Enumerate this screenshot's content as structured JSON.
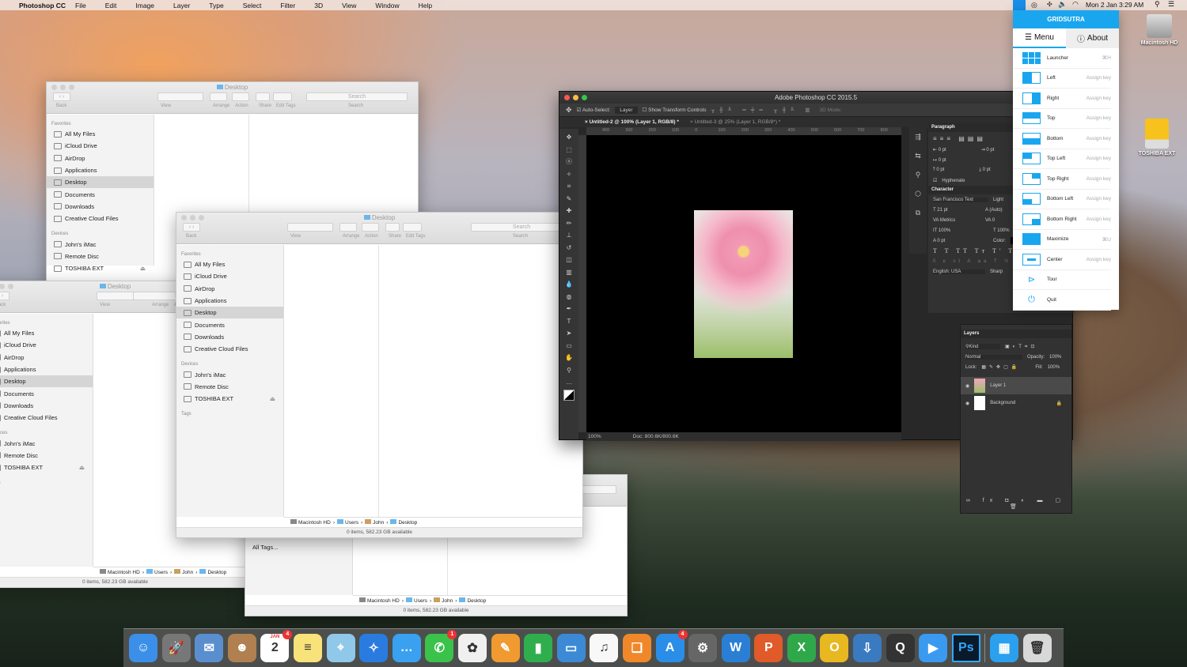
{
  "menubar": {
    "app": "Photoshop CC",
    "items": [
      "File",
      "Edit",
      "Image",
      "Layer",
      "Type",
      "Select",
      "Filter",
      "3D",
      "View",
      "Window",
      "Help"
    ],
    "clock": "Mon 2 Jan  3:29 AM"
  },
  "finder": {
    "title": "Desktop",
    "toolbar": {
      "back": "Back",
      "view": "View",
      "arrange": "Arrange",
      "action": "Action",
      "share": "Share",
      "edit_tags": "Edit Tags",
      "search_label": "Search",
      "search_placeholder": "Search"
    },
    "favorites_header": "Favorites",
    "favorites": [
      "All My Files",
      "iCloud Drive",
      "AirDrop",
      "Applications",
      "Desktop",
      "Documents",
      "Downloads",
      "Creative Cloud Files"
    ],
    "devices_header": "Devices",
    "devices": [
      "John's iMac",
      "Remote Disc",
      "TOSHIBA EXT"
    ],
    "tags_header": "Tags",
    "all_tags": "All Tags...",
    "path": [
      "Macintosh HD",
      "Users",
      "John",
      "Desktop"
    ],
    "status": "0 items, 582.23 GB available"
  },
  "photoshop": {
    "title": "Adobe Photoshop CC 2015.5",
    "auto_select": "Auto-Select:",
    "auto_select_value": "Layer",
    "show_transform": "Show Transform Controls",
    "mode_3d": "3D Mode:",
    "tabs": [
      "Untitled-2 @ 100% (Layer 1, RGB/8) *",
      "Untitled-3 @ 25% (Layer 1, RGB/8*) *"
    ],
    "ruler": [
      "400",
      "300",
      "200",
      "100",
      "0",
      "100",
      "200",
      "300",
      "400",
      "500",
      "600",
      "700",
      "800"
    ],
    "zoom": "100%",
    "doc": "Doc: 800.6K/800.6K",
    "paragraph": {
      "title": "Paragraph",
      "values": [
        "0 pt",
        "0 pt",
        "0 pt",
        "0 pt",
        "0 pt"
      ],
      "hyphenate": "Hyphenate"
    },
    "character": {
      "title": "Character",
      "font": "San Francisco Text",
      "style": "Light",
      "size": "21 pt",
      "leading": "(Auto)",
      "kerning": "Metrics",
      "tracking": "0",
      "vscale": "100%",
      "hscale": "100%",
      "baseline": "0 pt",
      "color_label": "Color:",
      "language": "English: USA",
      "aa": "Sharp"
    },
    "layers": {
      "title": "Layers",
      "filter": "Kind",
      "blend": "Normal",
      "opacity_label": "Opacity:",
      "opacity": "100%",
      "lock_label": "Lock:",
      "fill_label": "Fill:",
      "fill": "100%",
      "items": [
        "Layer 1",
        "Background"
      ]
    }
  },
  "gridsutra": {
    "title": "GRIDSUTRA",
    "tab_menu": "Menu",
    "tab_about": "About",
    "accent": "#1aa6ef",
    "items": [
      {
        "label": "Launcher",
        "key": "⌘H"
      },
      {
        "label": "Left",
        "key": "Assign key"
      },
      {
        "label": "Right",
        "key": "Assign key"
      },
      {
        "label": "Top",
        "key": "Assign key"
      },
      {
        "label": "Bottom",
        "key": "Assign key"
      },
      {
        "label": "Top Left",
        "key": "Assign key"
      },
      {
        "label": "Top Right",
        "key": "Assign key"
      },
      {
        "label": "Bottom Left",
        "key": "Assign key"
      },
      {
        "label": "Bottom Right",
        "key": "Assign key"
      },
      {
        "label": "Maximize",
        "key": "⌘U"
      },
      {
        "label": "Center",
        "key": "Assign key"
      },
      {
        "label": "Tour",
        "key": ""
      },
      {
        "label": "Quit",
        "key": ""
      }
    ]
  },
  "desktop_icons": [
    "Macintosh HD",
    "TOSHIBA EXT"
  ],
  "dock": [
    {
      "name": "finder",
      "color": "#3b8fe8",
      "glyph": "☺"
    },
    {
      "name": "launchpad",
      "color": "#777",
      "glyph": "🚀"
    },
    {
      "name": "mail",
      "color": "#5a8fcf",
      "glyph": "✉"
    },
    {
      "name": "contacts",
      "color": "#b08050",
      "glyph": "☻"
    },
    {
      "name": "calendar",
      "color": "#fff",
      "glyph": "2",
      "month": "JAN",
      "badge": "4"
    },
    {
      "name": "notes",
      "color": "#f8e27a",
      "glyph": "≡"
    },
    {
      "name": "maps",
      "color": "#8fc8e8",
      "glyph": "⌖"
    },
    {
      "name": "safari",
      "color": "#2a7be0",
      "glyph": "✧"
    },
    {
      "name": "messages",
      "color": "#3aa0f0",
      "glyph": "…"
    },
    {
      "name": "facetime",
      "color": "#3ac24a",
      "glyph": "✆",
      "badge": "1"
    },
    {
      "name": "photos",
      "color": "#f0f0f0",
      "glyph": "✿"
    },
    {
      "name": "pages",
      "color": "#f09a30",
      "glyph": "✎"
    },
    {
      "name": "numbers",
      "color": "#2fae4e",
      "glyph": "▮"
    },
    {
      "name": "keynote",
      "color": "#3c8ad6",
      "glyph": "▭"
    },
    {
      "name": "itunes",
      "color": "#f8f8f8",
      "glyph": "♫"
    },
    {
      "name": "ibooks",
      "color": "#f0882a",
      "glyph": "❑"
    },
    {
      "name": "app-store",
      "color": "#2a8ee8",
      "glyph": "A",
      "badge": "4"
    },
    {
      "name": "system-preferences",
      "color": "#666",
      "glyph": "⚙"
    },
    {
      "name": "word",
      "color": "#2a7fd4",
      "glyph": "W"
    },
    {
      "name": "powerpoint",
      "color": "#e05a2a",
      "glyph": "P"
    },
    {
      "name": "excel",
      "color": "#2fa84a",
      "glyph": "X"
    },
    {
      "name": "outlook",
      "color": "#e8b820",
      "glyph": "O"
    },
    {
      "name": "downloader",
      "color": "#3a7ac0",
      "glyph": "⇩"
    },
    {
      "name": "quicktime",
      "color": "#333",
      "glyph": "Q"
    },
    {
      "name": "video-player",
      "color": "#3a9af0",
      "glyph": "▶"
    },
    {
      "name": "photoshop",
      "color": "#0a1a2a",
      "glyph": "Ps"
    },
    {
      "name": "sep"
    },
    {
      "name": "gridsutra",
      "color": "#2aa0ee",
      "glyph": "▦"
    },
    {
      "name": "trash",
      "color": "#d8d8d8",
      "glyph": "🗑"
    }
  ]
}
